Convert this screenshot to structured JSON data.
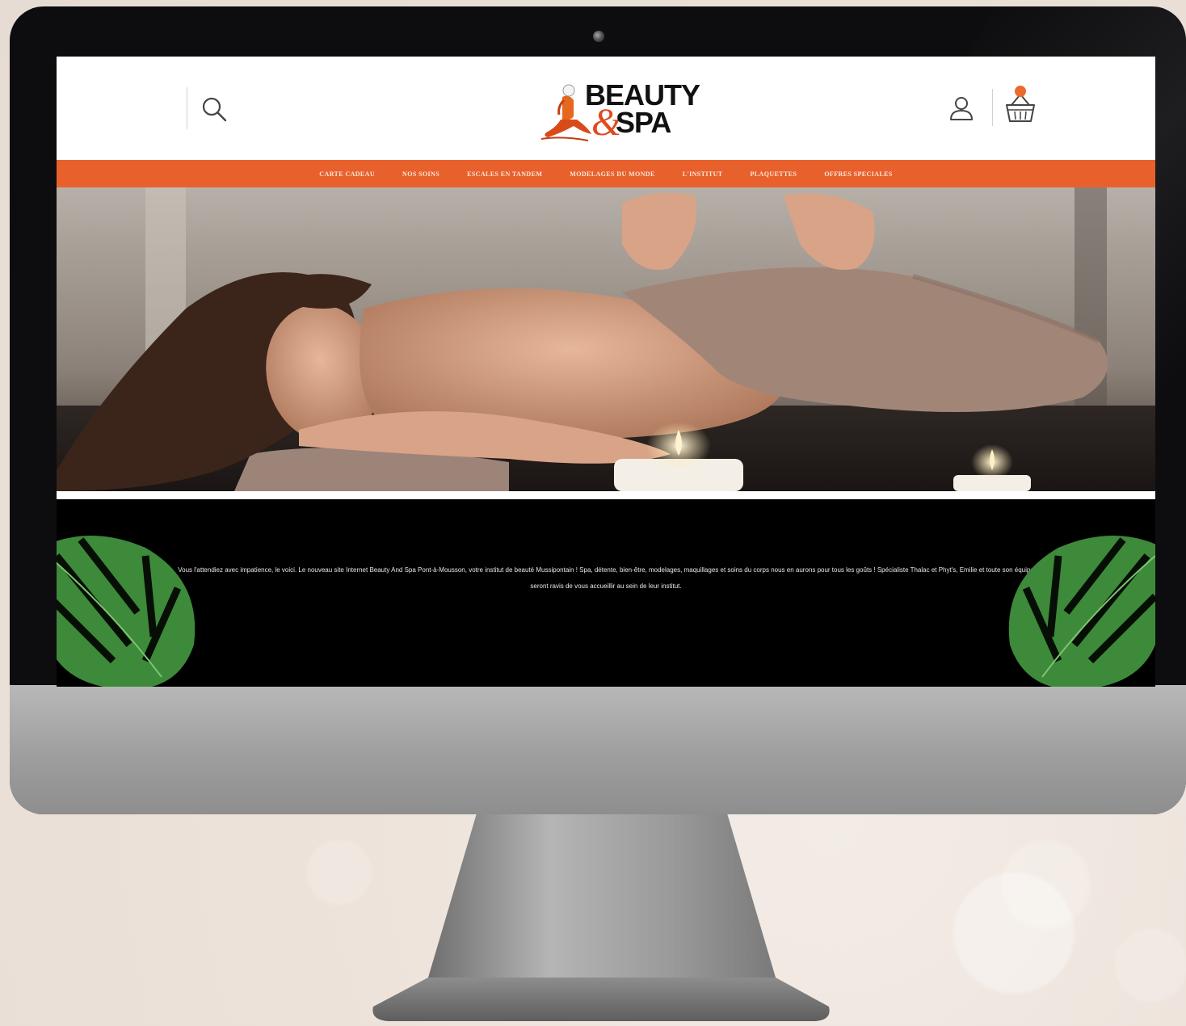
{
  "header": {
    "search_icon": "search-icon",
    "logo_text_top": "BEAUTY",
    "logo_ampersand": "&",
    "logo_text_bottom": "SPA",
    "user_icon": "user-icon",
    "cart_icon": "basket-icon",
    "cart_count": ""
  },
  "nav": {
    "items": [
      {
        "label": "CARTE CADEAU"
      },
      {
        "label": "NOS SOINS"
      },
      {
        "label": "ESCALES EN TANDEM"
      },
      {
        "label": "MODELAGES DU MONDE"
      },
      {
        "label": "L'INSTITUT"
      },
      {
        "label": "PLAQUETTES"
      },
      {
        "label": "OFFRES SPECIALES"
      }
    ]
  },
  "hero": {
    "image": "woman-receiving-massage-photo"
  },
  "intro": {
    "text": "Vous l'attendiez avec impatience, le voici. Le nouveau site Internet Beauty And Spa Pont-à-Mousson, votre institut de beauté Mussipontain ! Spa, détente, bien-être, modelages, maquillages et soins du corps nous en aurons pour tous les goûts ! Spécialiste Thalac et Phyt's, Emilie et toute son équipe seront ravis de vous accueillir au sein de leur institut."
  },
  "colors": {
    "accent": "#e8612c",
    "intro_bg": "#000000",
    "monitor_bezel": "#0d0d10",
    "monitor_chin": "#a0a0a0"
  }
}
